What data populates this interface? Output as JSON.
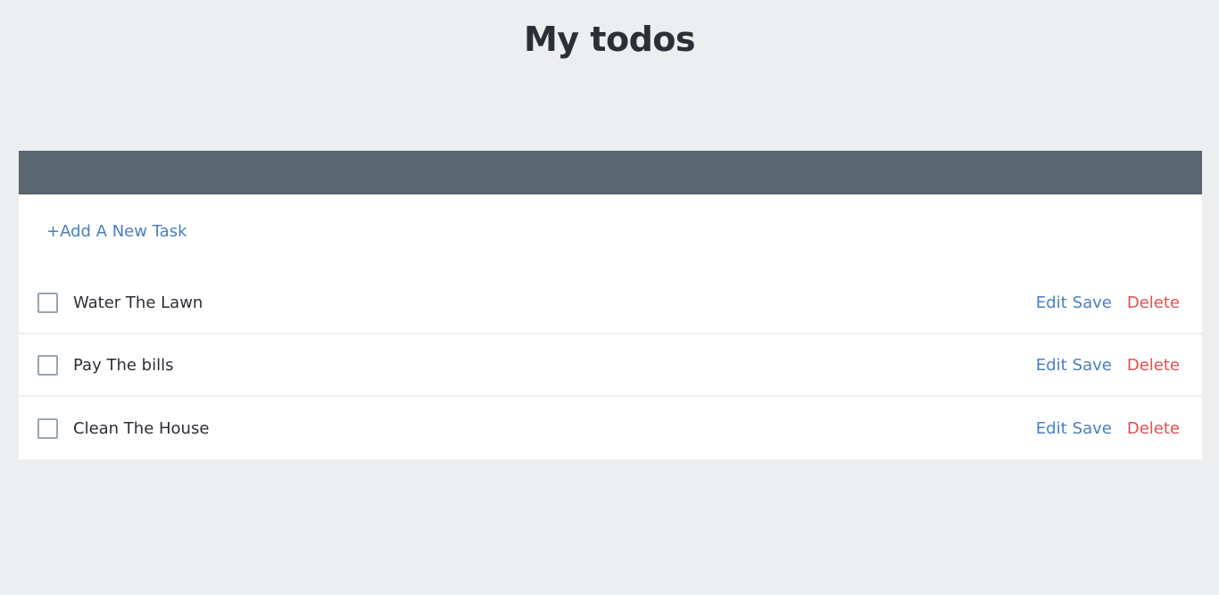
{
  "header": {
    "title": "My todos"
  },
  "add_task_label": "+Add A New Task",
  "tasks": [
    {
      "text": "Water The Lawn",
      "edit": "Edit",
      "save": "Save",
      "delete": "Delete"
    },
    {
      "text": "Pay The bills",
      "edit": "Edit",
      "save": "Save",
      "delete": "Delete"
    },
    {
      "text": "Clean The House",
      "edit": "Edit",
      "save": "Save",
      "delete": "Delete"
    }
  ],
  "colors": {
    "background": "#edeef0",
    "header_bar": "#5a6572",
    "link": "#4a7fc1",
    "delete": "#e0524f"
  }
}
